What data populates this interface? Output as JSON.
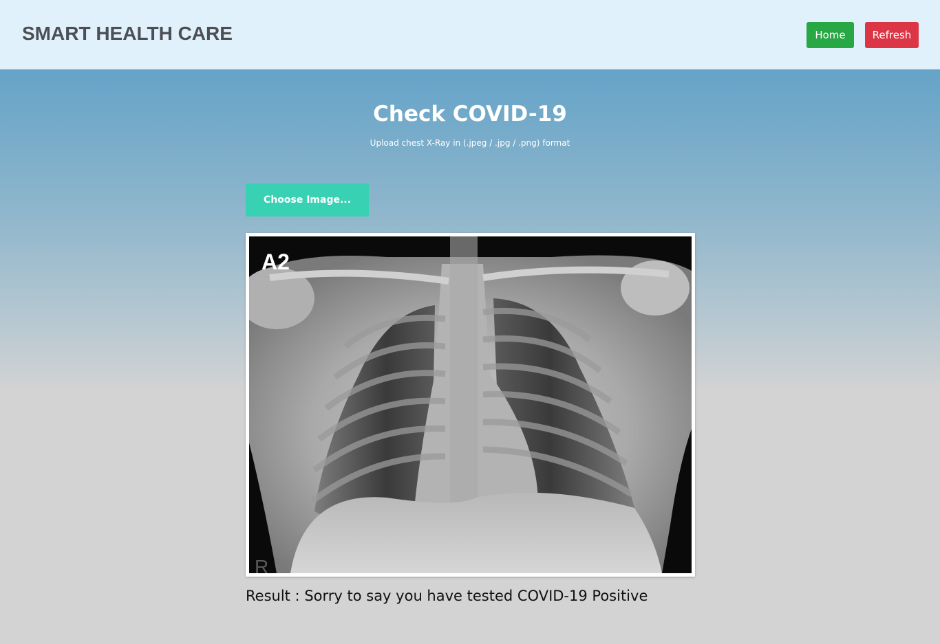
{
  "header": {
    "brand": "SMART HEALTH CARE",
    "home_label": "Home",
    "refresh_label": "Refresh"
  },
  "main": {
    "title": "Check COVID-19",
    "subtitle": "Upload chest X-Ray in (.jpeg / .jpg / .png) format",
    "choose_label": "Choose Image...",
    "xray": {
      "label": "A2",
      "marker": "R"
    },
    "result_text": "Result : Sorry to say you have tested COVID-19 Positive"
  },
  "colors": {
    "home": "#28a745",
    "refresh": "#dc3545",
    "choose": "#39d1b4",
    "navbar": "#e1f1fb"
  }
}
